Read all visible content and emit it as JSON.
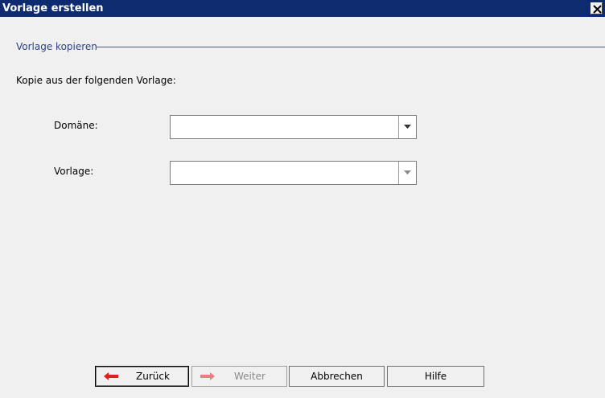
{
  "window": {
    "title": "Vorlage erstellen",
    "close_icon": "close-icon"
  },
  "section": {
    "title": "Vorlage kopieren"
  },
  "intro": {
    "text": "Kopie aus der folgenden Vorlage:"
  },
  "fields": {
    "domain": {
      "label": "Domäne:",
      "value": "",
      "icon": "chevron-down-icon"
    },
    "template": {
      "label": "Vorlage:",
      "value": "",
      "icon": "chevron-down-icon"
    }
  },
  "buttons": {
    "back": {
      "label": "Zurück",
      "icon": "arrow-left-icon",
      "color": "#e02020"
    },
    "next": {
      "label": "Weiter",
      "icon": "arrow-right-icon",
      "color": "#e88080"
    },
    "cancel": {
      "label": "Abbrechen"
    },
    "help": {
      "label": "Hilfe"
    }
  },
  "colors": {
    "titlebar": "#0d2b6e",
    "background": "#f0f0f0",
    "section_title": "#2f3f7f"
  }
}
